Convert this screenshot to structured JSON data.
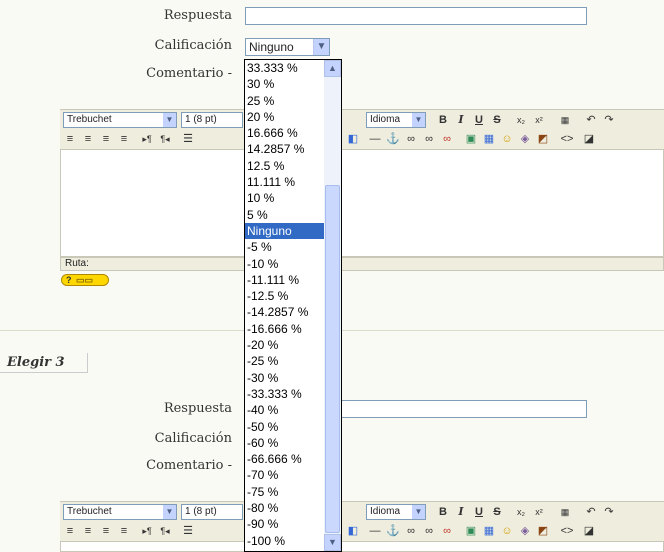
{
  "answers": [
    {
      "respuesta_label": "Respuesta",
      "calificacion_label": "Calificación",
      "calificacion_value": "Ninguno",
      "comentario_label": "Comentario -"
    },
    {
      "respuesta_label": "Respuesta",
      "calificacion_label": "Calificación",
      "comentario_label": "Comentario -"
    }
  ],
  "toolbar": {
    "font_family": "Trebuchet",
    "font_size": "1 (8 pt)",
    "language": "Idioma",
    "bold": "B",
    "italic": "I",
    "underline": "U",
    "strike": "S",
    "subscript": "x₂",
    "superscript": "x²"
  },
  "status": {
    "path_label": "Ruta:"
  },
  "section": {
    "title": "Elegir 3"
  },
  "dropdown": {
    "options": [
      "33.333 %",
      "30 %",
      "25 %",
      "20 %",
      "16.666 %",
      "14.2857 %",
      "12.5 %",
      "11.111 %",
      "10 %",
      "5 %",
      "Ninguno",
      "-5 %",
      "-10 %",
      "-11.111 %",
      "-12.5 %",
      "-14.2857 %",
      "-16.666 %",
      "-20 %",
      "-25 %",
      "-30 %",
      "-33.333 %",
      "-40 %",
      "-50 %",
      "-60 %",
      "-66.666 %",
      "-70 %",
      "-75 %",
      "-80 %",
      "-90 %",
      "-100 %"
    ],
    "selected": "Ninguno"
  },
  "colors": {
    "selection": "#316ac5",
    "toolbar_bg": "#efedde",
    "page_bg": "#fafaf5"
  }
}
